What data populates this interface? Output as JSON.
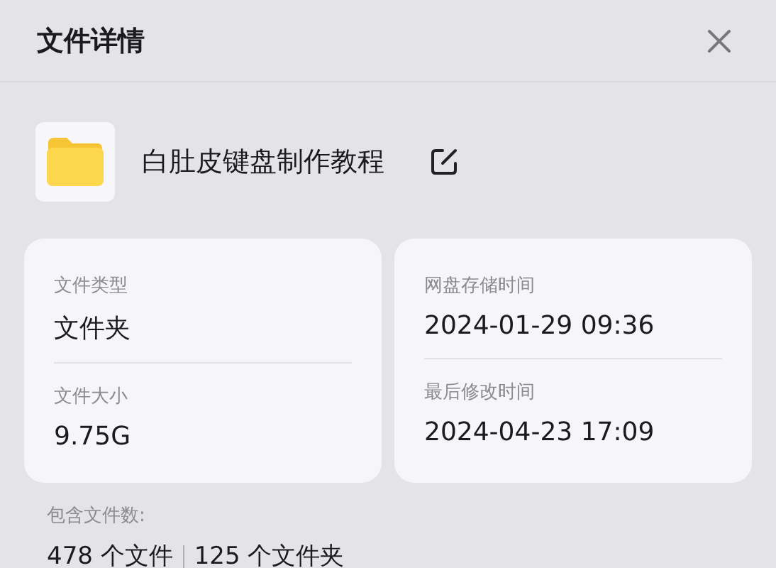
{
  "title": "文件详情",
  "file": {
    "name": "白肚皮键盘制作教程"
  },
  "cards": [
    {
      "fields": [
        {
          "label": "文件类型",
          "value": "文件夹"
        },
        {
          "label": "文件大小",
          "value": "9.75G"
        }
      ]
    },
    {
      "fields": [
        {
          "label": "网盘存储时间",
          "value": "2024-01-29 09:36"
        },
        {
          "label": "最后修改时间",
          "value": "2024-04-23 17:09"
        }
      ]
    }
  ],
  "contents": {
    "label": "包含文件数:",
    "items": [
      "478 个文件",
      "125 个文件夹"
    ]
  }
}
